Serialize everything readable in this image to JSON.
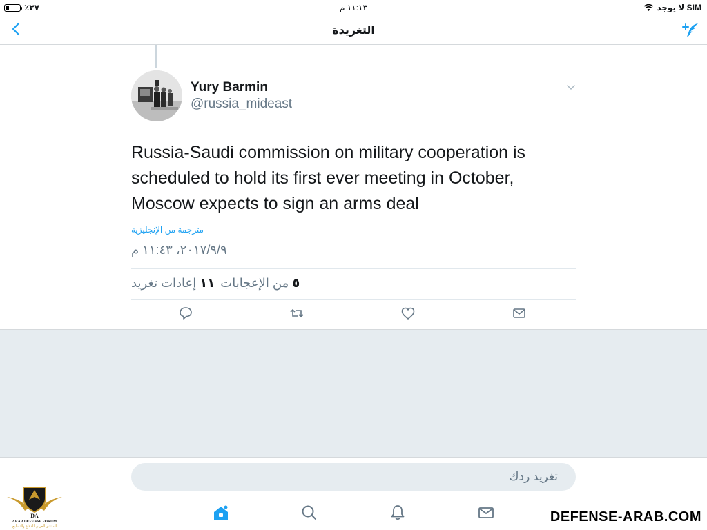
{
  "status_bar": {
    "battery": "٪٢٧",
    "battery_level": 0.27,
    "time": "١١:١٣ م",
    "carrier": "لا يوجد SIM"
  },
  "nav": {
    "title": "التغريدة",
    "back_icon": "chevron-left-icon",
    "compose_icon": "compose-tweet-icon"
  },
  "tweet": {
    "author_name": "Yury Barmin",
    "author_handle": "@russia_mideast",
    "text": "Russia-Saudi commission on military cooperation is scheduled to hold its first ever meeting in October, Moscow expects to sign an arms deal",
    "translated_label": "مترجمة من الإنجليزية",
    "timestamp": "٢٠١٧/٩/٩، ١١:٤٣ م",
    "likes_count": "٥",
    "likes_label": "من الإعجابات",
    "retweets_count": "١١",
    "retweets_label": "إعادات تغريد",
    "actions": [
      "reply-icon",
      "retweet-icon",
      "like-icon",
      "direct-message-icon"
    ]
  },
  "reply": {
    "placeholder": "تغريد ردك"
  },
  "tabs": [
    "home-icon",
    "search-icon",
    "notifications-icon",
    "messages-icon"
  ],
  "watermark": {
    "logo_text": "ARAB DEFENSE FORUM",
    "logo_initials": "DA",
    "logo_subtitle": "المنتدى العربي للدفاع والتسليح",
    "site": "DEFENSE-ARAB.COM"
  },
  "colors": {
    "accent": "#1da1f2",
    "text_secondary": "#657786",
    "background_grey": "#e6ecf0"
  }
}
